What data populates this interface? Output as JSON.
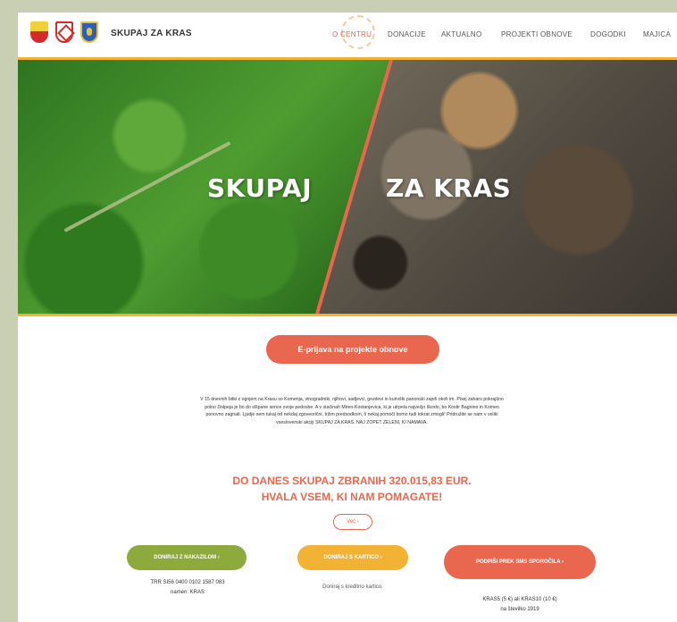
{
  "header": {
    "brand": "SKUPAJ ZA KRAS",
    "nav": [
      "O CENTRU",
      "DONACIJE",
      "AKTUALNO",
      "PROJEKTI OBNOVE",
      "DOGODKI",
      "MAJICA"
    ],
    "active_nav": "O CENTRU"
  },
  "hero": {
    "left_word": "SKUPAJ",
    "right_word": "ZA KRAS"
  },
  "apply_button": "E-prijava na projekte obnove",
  "intro_text": "V 15 dnevnih bitki z ognjem na Krasu so Komenja, vinogradniki, njihovi, sadjevci, gozdovi in kurivški panonski zaprli okoli im. Pisej zaharo pokrajšno polno Dolpeja je bo do slšpane sence svoje pedosbe. A v stačinah Miren-Kostanjevica, ki je utrpela največjo škodo, bo Kostir Bagnino in Komen ponovno zagnati. Ljudje sem tukaj od nekdaj zgoveorični, tržim predsodkom, š nekaj pomoči bomo tudi tokrat zmogli! Pridružite se nam v veliki vseslovenski akciji SKUPAJ ZA KRAS. NAJ ZOPET ZELENI, KI NAMAVA.",
  "amount_line1": "DO DANES SKUPAJ ZBRANIH 320.015,83 EUR.",
  "amount_line2": "HVALA VSEM, KI NAM POMAGATE!",
  "more_button": "Več ›",
  "donate": {
    "bank_button": "DONIRAJ Z NAKAZILOM ›",
    "card_button": "DONIRAJ S KARTICO ›",
    "sms_button": "PODPIŠI PREK SMS SPOROČILA ›",
    "bank_info_line1": "TRR SI56 0400 0102 1587 083",
    "bank_info_line2": "namen: KRAS",
    "card_info": "Doniraj s kreditno kartico.",
    "sms_info_line1": "KRAS5 (5 €) ali KRAS10 (10 €)",
    "sms_info_line2": "na številko 1919"
  },
  "colors": {
    "accent_coral": "#e9674e",
    "accent_yellow": "#f2b233",
    "accent_green": "#8faa3c",
    "frame_background": "#c9cfb2"
  }
}
